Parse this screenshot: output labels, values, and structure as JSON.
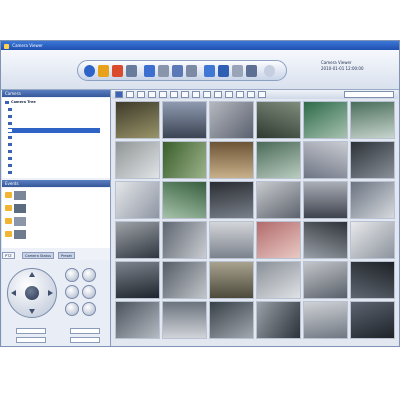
{
  "window": {
    "title": "Camera Viewer"
  },
  "toolbar": {
    "info_lines": [
      "Camera Viewer",
      "2010-01-01 12:00:00"
    ],
    "buttons": [
      "home-icon",
      "record-icon",
      "alarm-icon",
      "tools-icon",
      "monitor-icon",
      "camera-icon",
      "search-icon",
      "playback-icon",
      "network-icon",
      "user-icon",
      "key-icon",
      "settings-icon",
      "help-icon"
    ]
  },
  "left_panel": {
    "tree_header": "Camera",
    "tree_search_placeholder": "",
    "tree_title": "Camera Tree",
    "events_header": "Events",
    "ptz_tabs": [
      "PTZ",
      "Camera Status",
      "Preset"
    ]
  },
  "grid": {
    "layout_select": ""
  },
  "colors": {
    "accent": "#2f63c6",
    "titlebar": "#1f4fb0",
    "panel": "#eef2f8"
  }
}
